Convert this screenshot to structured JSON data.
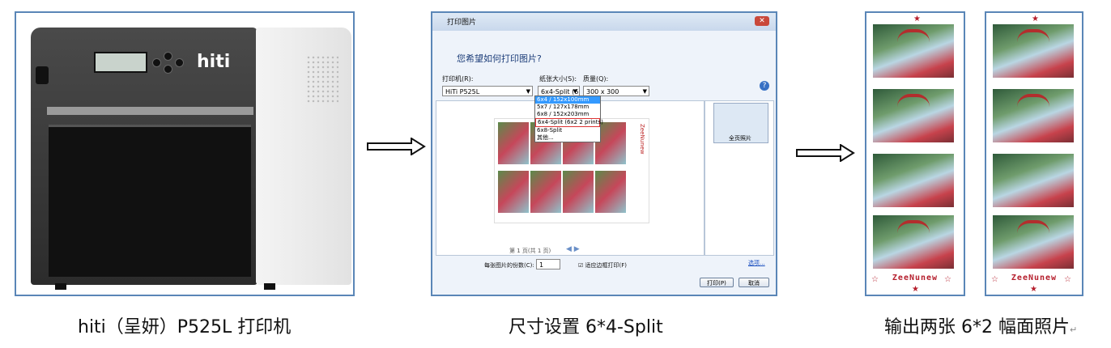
{
  "figure": {
    "captions": {
      "printer": "hiti（呈妍）P525L 打印机",
      "dialog": "尺寸设置 6*4-Split",
      "output": "输出两张 6*2 幅面照片"
    },
    "output_return_mark": "↵"
  },
  "printer": {
    "brand_logo": "hiti"
  },
  "dialog": {
    "title": "打印图片",
    "close_glyph": "✕",
    "question": "您希望如何打印图片?",
    "printer_label": "打印机(R):",
    "printer_value": "HiTi P525L",
    "paper_label": "纸张大小(S):",
    "paper_value": "6x4-Split (6",
    "quality_label": "质量(Q):",
    "quality_value": "300 x 300",
    "paper_options": [
      "6x4 / 152x100mm",
      "5x7 / 127x178mm",
      "6x8 / 152x203mm",
      "6x4-Split (6x2 2 prints)",
      "6x8-Split",
      "其他..."
    ],
    "thumb_label": "全页照片",
    "page_indicator": "第 1 页(共 1 页)",
    "copies_label": "每张图片的份数(C):",
    "copies_value": "1",
    "fit_label": "适应边框打印(F)",
    "options_link": "选项...",
    "print_button": "打印(P)",
    "cancel_button": "取消",
    "sheet_brand": "ZeeNunew"
  },
  "strips": {
    "brand": "ZeeNunew"
  }
}
